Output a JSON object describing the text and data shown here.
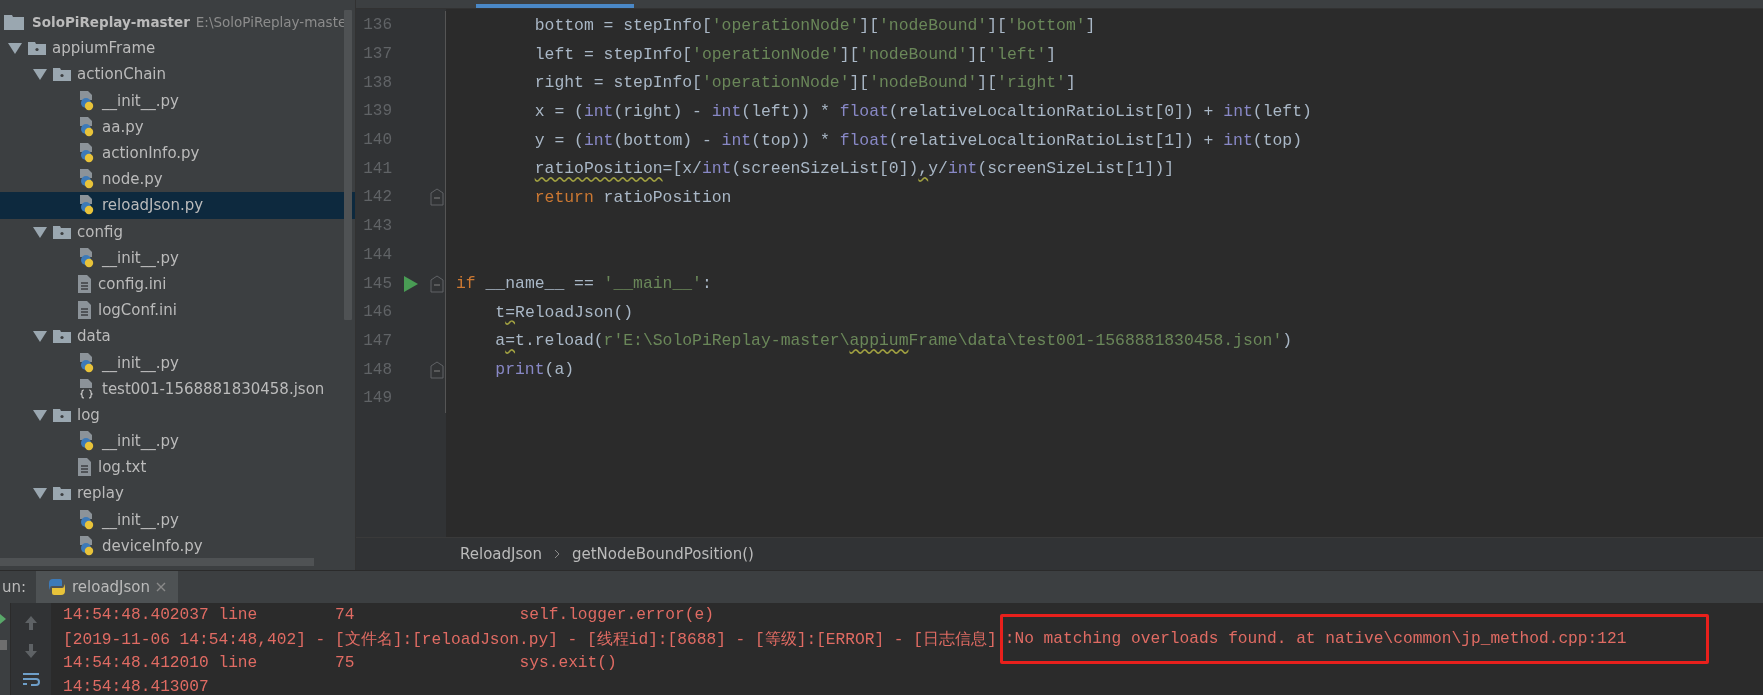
{
  "project": {
    "name": "SoloPiReplay-master",
    "path": "E:\\SoloPiReplay-maste",
    "tree": [
      {
        "label": "appiumFrame",
        "kind": "folder",
        "expanded": true,
        "selected": false,
        "children": [
          {
            "label": "actionChain",
            "kind": "folder",
            "expanded": true,
            "selected": false,
            "children": [
              {
                "label": "__init__.py",
                "kind": "python",
                "selected": false
              },
              {
                "label": "aa.py",
                "kind": "python",
                "selected": false
              },
              {
                "label": "actionInfo.py",
                "kind": "python",
                "selected": false
              },
              {
                "label": "node.py",
                "kind": "python",
                "selected": false
              },
              {
                "label": "reloadJson.py",
                "kind": "python",
                "selected": true
              }
            ]
          },
          {
            "label": "config",
            "kind": "folder",
            "expanded": true,
            "selected": false,
            "children": [
              {
                "label": "__init__.py",
                "kind": "python",
                "selected": false
              },
              {
                "label": "config.ini",
                "kind": "text",
                "selected": false
              },
              {
                "label": "logConf.ini",
                "kind": "text",
                "selected": false
              }
            ]
          },
          {
            "label": "data",
            "kind": "folder",
            "expanded": true,
            "selected": false,
            "children": [
              {
                "label": "__init__.py",
                "kind": "python",
                "selected": false
              },
              {
                "label": "test001-1568881830458.json",
                "kind": "json",
                "selected": false
              }
            ]
          },
          {
            "label": "log",
            "kind": "folder",
            "expanded": true,
            "selected": false,
            "children": [
              {
                "label": "__init__.py",
                "kind": "python",
                "selected": false
              },
              {
                "label": "log.txt",
                "kind": "text",
                "selected": false
              }
            ]
          },
          {
            "label": "replay",
            "kind": "folder",
            "expanded": true,
            "selected": false,
            "children": [
              {
                "label": "__init__.py",
                "kind": "python",
                "selected": false
              },
              {
                "label": "deviceInfo.py",
                "kind": "python",
                "selected": false
              }
            ]
          }
        ]
      }
    ]
  },
  "editor": {
    "lines": [
      {
        "number": "136",
        "fold": false,
        "run": false,
        "tokens": [
          {
            "text": "        bottom = stepInfo[",
            "kind": "plain"
          },
          {
            "text": "'operationNode'",
            "kind": "string"
          },
          {
            "text": "][",
            "kind": "plain"
          },
          {
            "text": "'nodeBound'",
            "kind": "string"
          },
          {
            "text": "][",
            "kind": "plain"
          },
          {
            "text": "'bottom'",
            "kind": "string"
          },
          {
            "text": "]",
            "kind": "plain"
          }
        ]
      },
      {
        "number": "137",
        "fold": false,
        "run": false,
        "tokens": [
          {
            "text": "        left = stepInfo[",
            "kind": "plain"
          },
          {
            "text": "'operationNode'",
            "kind": "string"
          },
          {
            "text": "][",
            "kind": "plain"
          },
          {
            "text": "'nodeBound'",
            "kind": "string"
          },
          {
            "text": "][",
            "kind": "plain"
          },
          {
            "text": "'left'",
            "kind": "string"
          },
          {
            "text": "]",
            "kind": "plain"
          }
        ]
      },
      {
        "number": "138",
        "fold": false,
        "run": false,
        "tokens": [
          {
            "text": "        right = stepInfo[",
            "kind": "plain"
          },
          {
            "text": "'operationNode'",
            "kind": "string"
          },
          {
            "text": "][",
            "kind": "plain"
          },
          {
            "text": "'nodeBound'",
            "kind": "string"
          },
          {
            "text": "][",
            "kind": "plain"
          },
          {
            "text": "'right'",
            "kind": "string"
          },
          {
            "text": "]",
            "kind": "plain"
          }
        ]
      },
      {
        "number": "139",
        "fold": false,
        "run": false,
        "tokens": [
          {
            "text": "        x = (",
            "kind": "plain"
          },
          {
            "text": "int",
            "kind": "builtin"
          },
          {
            "text": "(right) - ",
            "kind": "plain"
          },
          {
            "text": "int",
            "kind": "builtin"
          },
          {
            "text": "(left)) * ",
            "kind": "plain"
          },
          {
            "text": "float",
            "kind": "builtin"
          },
          {
            "text": "(relativeLocaltionRatioList[0]) + ",
            "kind": "plain"
          },
          {
            "text": "int",
            "kind": "builtin"
          },
          {
            "text": "(left)",
            "kind": "plain"
          }
        ]
      },
      {
        "number": "140",
        "fold": false,
        "run": false,
        "tokens": [
          {
            "text": "        y = (",
            "kind": "plain"
          },
          {
            "text": "int",
            "kind": "builtin"
          },
          {
            "text": "(bottom) - ",
            "kind": "plain"
          },
          {
            "text": "int",
            "kind": "builtin"
          },
          {
            "text": "(top)) * ",
            "kind": "plain"
          },
          {
            "text": "float",
            "kind": "builtin"
          },
          {
            "text": "(relativeLocaltionRatioList[1]) + ",
            "kind": "plain"
          },
          {
            "text": "int",
            "kind": "builtin"
          },
          {
            "text": "(top)",
            "kind": "plain"
          }
        ]
      },
      {
        "number": "141",
        "fold": false,
        "run": false,
        "tokens": [
          {
            "text": "        ratioPosition",
            "kind": "warning"
          },
          {
            "text": "=[x/",
            "kind": "plain"
          },
          {
            "text": "int",
            "kind": "builtin"
          },
          {
            "text": "(screenSizeList[0])",
            "kind": "plain"
          },
          {
            "text": ",",
            "kind": "warning"
          },
          {
            "text": "y/",
            "kind": "plain"
          },
          {
            "text": "int",
            "kind": "builtin"
          },
          {
            "text": "(screenSizeList[1])]",
            "kind": "plain"
          }
        ]
      },
      {
        "number": "142",
        "fold": true,
        "run": false,
        "tokens": [
          {
            "text": "        return",
            "kind": "keyword"
          },
          {
            "text": " ratioPosition",
            "kind": "plain"
          }
        ]
      },
      {
        "number": "143",
        "fold": false,
        "run": false
      },
      {
        "number": "144",
        "fold": false,
        "run": false
      },
      {
        "number": "145",
        "fold": true,
        "run": true,
        "tokens": [
          {
            "text": "if",
            "kind": "keyword"
          },
          {
            "text": " __name__ == ",
            "kind": "plain"
          },
          {
            "text": "'__main__'",
            "kind": "string"
          },
          {
            "text": ":",
            "kind": "plain"
          }
        ]
      },
      {
        "number": "146",
        "fold": false,
        "run": false,
        "tokens": [
          {
            "text": "    t",
            "kind": "plain"
          },
          {
            "text": "=",
            "kind": "warning"
          },
          {
            "text": "ReloadJson()",
            "kind": "plain"
          }
        ]
      },
      {
        "number": "147",
        "fold": false,
        "run": false,
        "tokens": [
          {
            "text": "    a",
            "kind": "plain"
          },
          {
            "text": "=",
            "kind": "warning"
          },
          {
            "text": "t.reload(",
            "kind": "plain"
          },
          {
            "text": "r'E:\\SoloPiReplay-master\\",
            "kind": "string"
          },
          {
            "text": "appium",
            "kind": "string-typo"
          },
          {
            "text": "Frame\\data\\test001-1568881830458.json'",
            "kind": "string"
          },
          {
            "text": ")",
            "kind": "plain"
          }
        ]
      },
      {
        "number": "148",
        "fold": true,
        "run": false,
        "tokens": [
          {
            "text": "    print",
            "kind": "builtin"
          },
          {
            "text": "(a)",
            "kind": "plain"
          }
        ]
      },
      {
        "number": "149",
        "fold": false,
        "run": false
      }
    ],
    "breadcrumbs": [
      "ReloadJson",
      "getNodeBoundPosition()"
    ]
  },
  "run_panel": {
    "label": "un:",
    "tabs": [
      {
        "label": "reloadJson",
        "selected": true
      }
    ],
    "console": [
      [
        {
          "text": "14:54:48.402037 line        74                 self.logger.error(e)",
          "highlighted": false
        }
      ],
      [
        {
          "text": "[2019-11-06 14:54:48,402] - [文件名]:[reloadJson.py] - [线程id]:[8688] - [等级]:[ERROR] - [日志信息]",
          "highlighted": false
        },
        {
          "text": ":No matching overloads found. at native\\common\\jp_method.cpp:121",
          "highlighted": true
        }
      ],
      [
        {
          "text": "14:54:48.412010 line        75                 sys.exit()",
          "highlighted": false
        }
      ],
      [
        {
          "text": "14:54:48.413007",
          "highlighted": false
        }
      ]
    ]
  }
}
